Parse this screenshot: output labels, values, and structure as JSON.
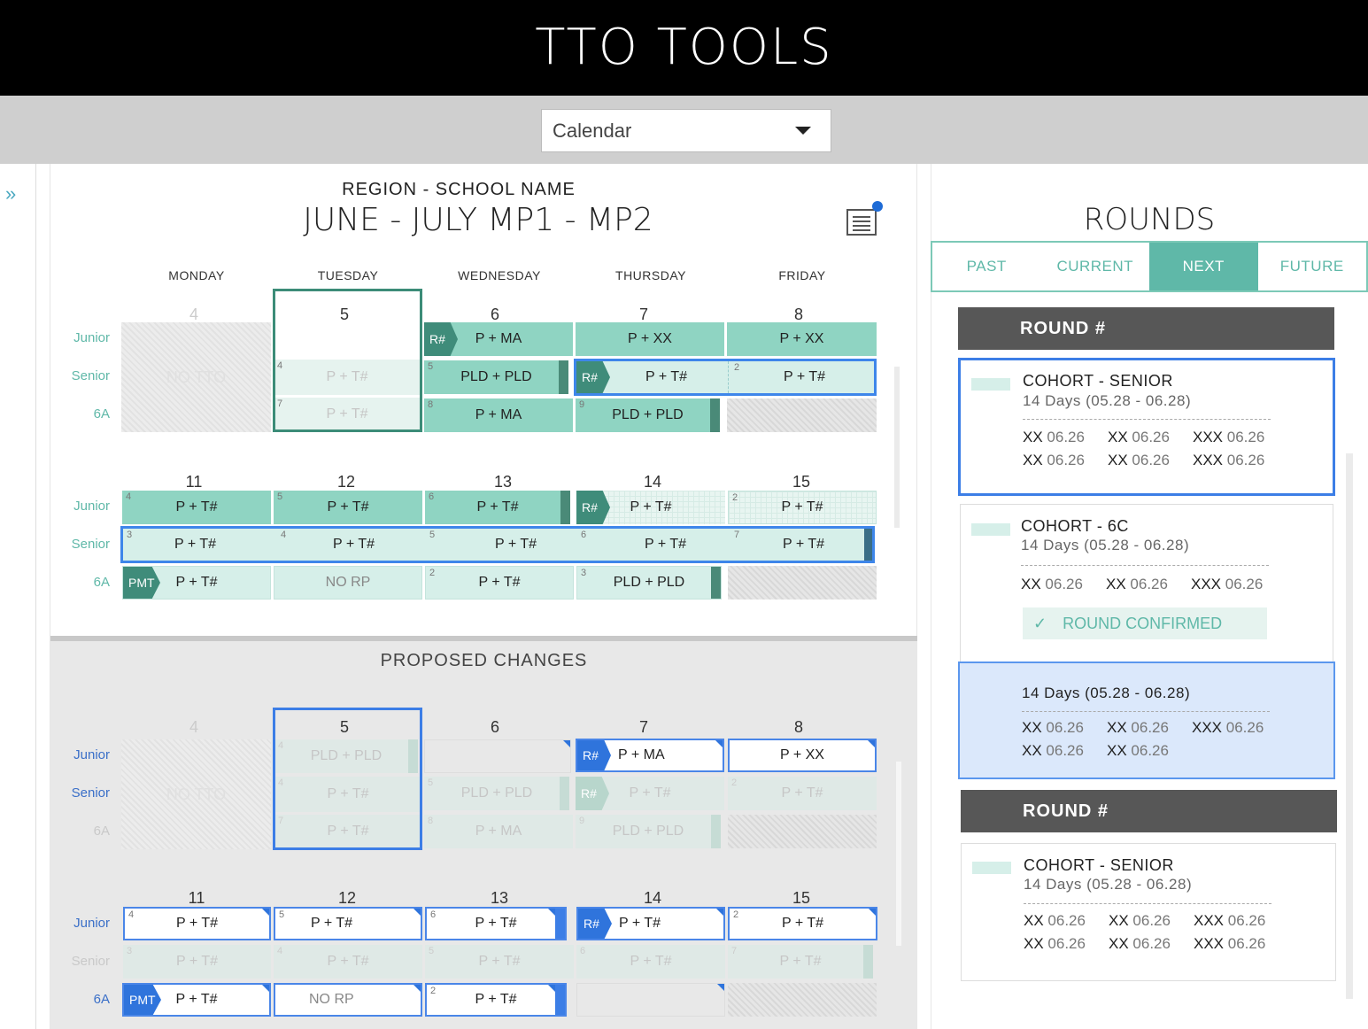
{
  "app": {
    "title": "TTO TOOLS"
  },
  "view_select": {
    "value": "Calendar"
  },
  "calendar": {
    "region": "REGION - SCHOOL NAME",
    "period": "JUNE - JULY  MP1 - MP2",
    "days": [
      "MONDAY",
      "TUESDAY",
      "WEDNESDAY",
      "THURSDAY",
      "FRIDAY"
    ],
    "rows": [
      "Junior",
      "Senior",
      "6A"
    ],
    "week1": [
      "4",
      "5",
      "6",
      "7",
      "8"
    ],
    "week2": [
      "11",
      "12",
      "13",
      "14",
      "15"
    ],
    "no_tto": "NO TTO",
    "no_rp": "NO RP",
    "tags": {
      "r": "R#",
      "pmt": "PMT"
    },
    "labels": {
      "pma": "P + MA",
      "pxx": "P + XX",
      "pt": "P + T#",
      "pldpld": "PLD + PLD"
    },
    "nums": {
      "n2": "2",
      "n3": "3",
      "n4": "4",
      "n5": "5",
      "n6": "6",
      "n7": "7",
      "n8": "8",
      "n9": "9"
    }
  },
  "proposed": {
    "title": "PROPOSED CHANGES"
  },
  "rounds": {
    "title": "ROUNDS",
    "tabs": [
      "PAST",
      "CURRENT",
      "NEXT",
      "FUTURE"
    ],
    "round_header": "ROUND #",
    "cohort_senior": "COHORT - SENIOR",
    "cohort_6c": "COHORT - 6C",
    "days_range": "14 Days (05.28 - 06.28)",
    "xx": "XX",
    "xxx": "XXX",
    "date": "06.26",
    "confirmed": "ROUND CONFIRMED",
    "check": "✓"
  }
}
